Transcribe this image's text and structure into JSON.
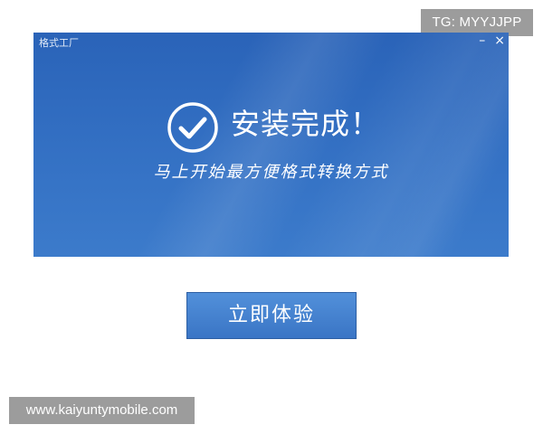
{
  "watermarks": {
    "top_right": "TG: MYYJJPP",
    "bottom_left": "www.kaiyuntymobile.com"
  },
  "window": {
    "title": "格式工厂",
    "minimize_label": "–",
    "close_label": "×"
  },
  "main": {
    "headline": "安装完成！",
    "subtitle": "马上开始最方便格式转换方式",
    "icon": "check-circle-icon"
  },
  "actions": {
    "start_label": "立即体验"
  },
  "colors": {
    "window_bg": "#2f6bc0",
    "button_bg": "#4683d0",
    "watermark_bg": "#9c9c9c"
  }
}
